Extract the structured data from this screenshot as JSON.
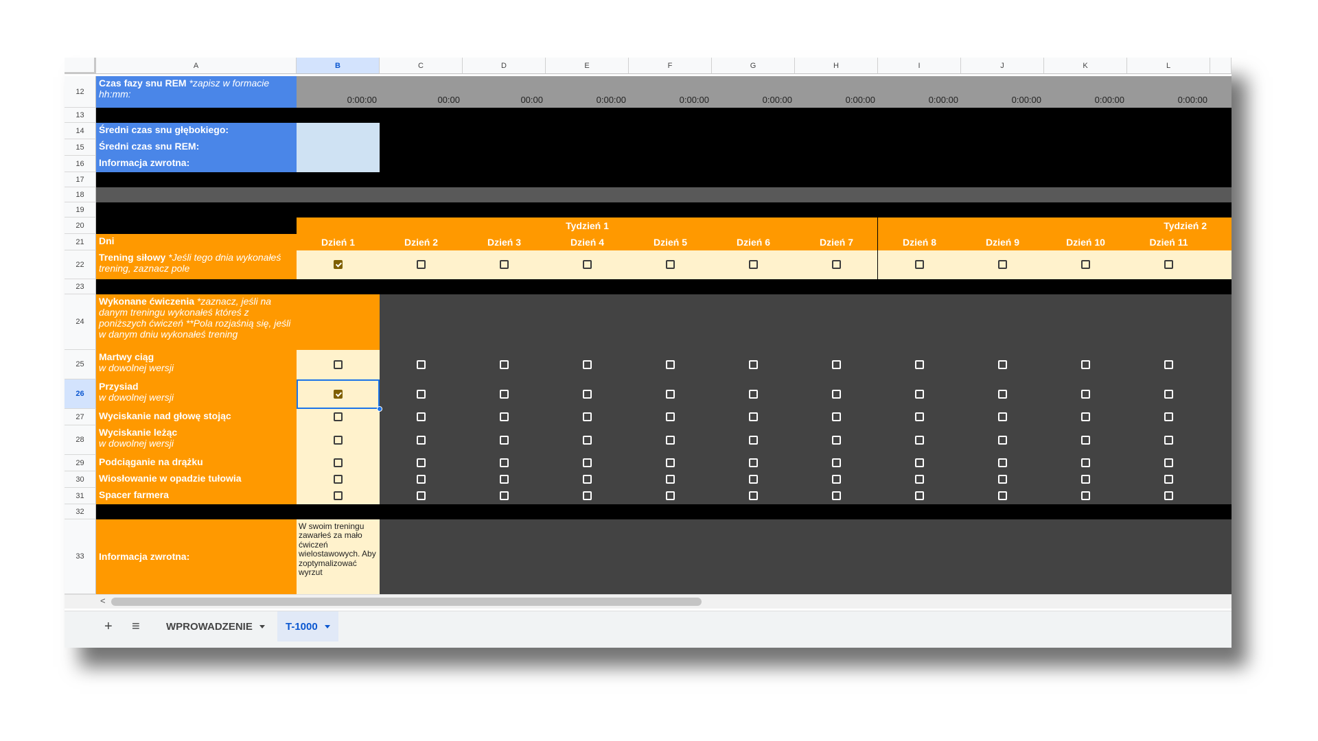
{
  "columns": [
    "A",
    "B",
    "C",
    "D",
    "E",
    "F",
    "G",
    "H",
    "I",
    "J",
    "K",
    "L"
  ],
  "selected_column": "B",
  "selected_row": "26",
  "rows": {
    "r12": "12",
    "r13": "13",
    "r14": "14",
    "r15": "15",
    "r16": "16",
    "r17": "17",
    "r18": "18",
    "r19": "19",
    "r20": "20",
    "r21": "21",
    "r22": "22",
    "r23": "23",
    "r24": "24",
    "r25": "25",
    "r26": "26",
    "r27": "27",
    "r28": "28",
    "r29": "29",
    "r30": "30",
    "r31": "31",
    "r32": "32",
    "r33": "33"
  },
  "rem": {
    "label": "Czas fazy snu REM",
    "hint": "*zapisz w formacie hh:mm:",
    "values": [
      "0:00:00",
      "00:00",
      "00:00",
      "0:00:00",
      "0:00:00",
      "0:00:00",
      "0:00:00",
      "0:00:00",
      "0:00:00",
      "0:00:00",
      "0:00:00"
    ]
  },
  "summary": {
    "deep": "Średni czas snu głębokiego:",
    "rem": "Średni czas snu REM:",
    "feedback": "Informacja zwrotna:"
  },
  "weeks": {
    "week1": "Tydzień 1",
    "week2": "Tydzień 2"
  },
  "days_label": "Dni",
  "days": [
    "Dzień 1",
    "Dzień 2",
    "Dzień 3",
    "Dzień 4",
    "Dzień 5",
    "Dzień 6",
    "Dzień 7",
    "Dzień 8",
    "Dzień 9",
    "Dzień 10",
    "Dzień 11"
  ],
  "training": {
    "label": "Trening siłowy",
    "hint": "*Jeśli tego dnia wykonałeś trening, zaznacz pole",
    "checked": [
      true,
      false,
      false,
      false,
      false,
      false,
      false,
      false,
      false,
      false,
      false
    ]
  },
  "exercises_header": {
    "label": "Wykonane ćwiczenia",
    "hint": "*zaznacz, jeśli na danym treningu wykonałeś któreś z poniższych ćwiczeń **Pola rozjaśnią się, jeśli w danym dniu wykonałeś trening"
  },
  "exercises": [
    {
      "name": "Martwy ciąg",
      "sub": "w dowolnej wersji",
      "checked_day1": false
    },
    {
      "name": "Przysiad",
      "sub": "w dowolnej wersji",
      "checked_day1": true
    },
    {
      "name": "Wyciskanie nad głowę stojąc",
      "sub": "",
      "checked_day1": false
    },
    {
      "name": "Wyciskanie leżąc",
      "sub": "w dowolnej wersji",
      "checked_day1": false
    },
    {
      "name": "Podciąganie na drążku",
      "sub": "",
      "checked_day1": false
    },
    {
      "name": "Wiosłowanie w opadzie tułowia",
      "sub": "",
      "checked_day1": false
    },
    {
      "name": "Spacer farmera",
      "sub": "",
      "checked_day1": false
    }
  ],
  "feedback_label": "Informacja zwrotna:",
  "feedback_text": "W swoim treningu zawarłeś za mało ćwiczeń wielostawowych. Aby zoptymalizować wyrzut",
  "tabs": {
    "add": "+",
    "menu": "≡",
    "sheet1": "WPROWADZENIE",
    "sheet2": "T-1000"
  },
  "scroll_left": "<",
  "colors": {
    "blue": "#4a86e8",
    "orange": "#ff9900",
    "cream": "#fff2cc",
    "dark": "#434343",
    "selected": "#d3e3fd"
  }
}
